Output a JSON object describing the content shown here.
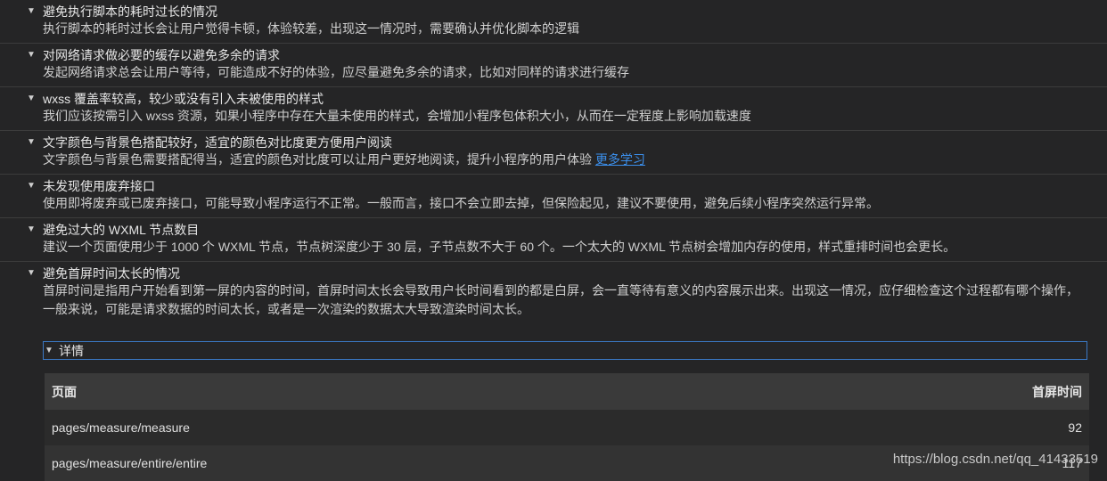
{
  "audits": [
    {
      "title": "避免执行脚本的耗时过长的情况",
      "desc": "执行脚本的耗时过长会让用户觉得卡顿，体验较差，出现这一情况时，需要确认并优化脚本的逻辑"
    },
    {
      "title": "对网络请求做必要的缓存以避免多余的请求",
      "desc": "发起网络请求总会让用户等待，可能造成不好的体验，应尽量避免多余的请求，比如对同样的请求进行缓存"
    },
    {
      "title": "wxss 覆盖率较高，较少或没有引入未被使用的样式",
      "desc": "我们应该按需引入 wxss 资源，如果小程序中存在大量未使用的样式，会增加小程序包体积大小，从而在一定程度上影响加载速度"
    },
    {
      "title": "文字颜色与背景色搭配较好，适宜的颜色对比度更方便用户阅读",
      "desc": "文字颜色与背景色需要搭配得当，适宜的颜色对比度可以让用户更好地阅读，提升小程序的用户体验",
      "link": "更多学习"
    },
    {
      "title": "未发现使用废弃接口",
      "desc": "使用即将废弃或已废弃接口，可能导致小程序运行不正常。一般而言，接口不会立即去掉，但保险起见，建议不要使用，避免后续小程序突然运行异常。"
    },
    {
      "title": "避免过大的 WXML 节点数目",
      "desc": "建议一个页面使用少于 1000 个 WXML 节点，节点树深度少于 30 层，子节点数不大于 60 个。一个太大的 WXML 节点树会增加内存的使用，样式重排时间也会更长。"
    },
    {
      "title": "避免首屏时间太长的情况",
      "desc": "首屏时间是指用户开始看到第一屏的内容的时间，首屏时间太长会导致用户长时间看到的都是白屏，会一直等待有意义的内容展示出来。出现这一情况，应仔细检查这个过程都有哪个操作，一般来说，可能是请求数据的时间太长，或者是一次渲染的数据太大导致渲染时间太长。"
    }
  ],
  "details": {
    "summary": "详情",
    "table": {
      "headers": [
        "页面",
        "首屏时间"
      ],
      "rows": [
        [
          "pages/measure/measure",
          "92"
        ],
        [
          "pages/measure/entire/entire",
          "117"
        ]
      ]
    }
  },
  "watermark": "https://blog.csdn.net/qq_41433519"
}
